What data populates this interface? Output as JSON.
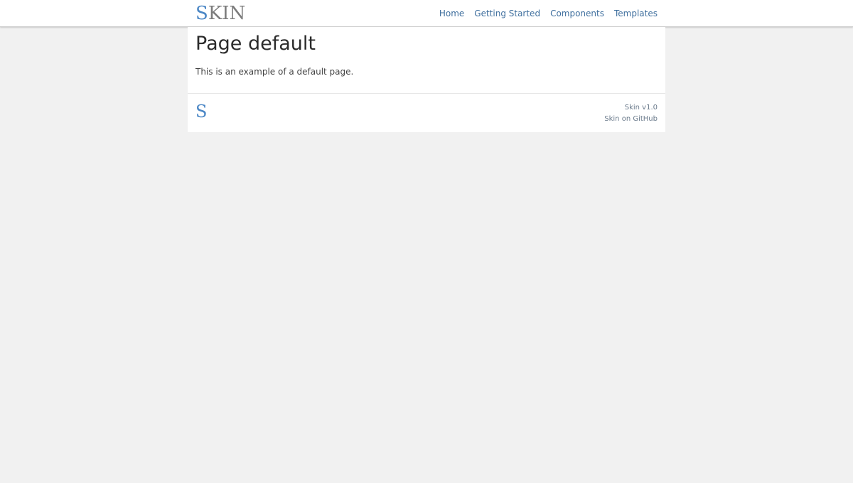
{
  "header": {
    "logo": {
      "first_letter": "S",
      "rest": "KIN"
    },
    "nav": [
      {
        "label": "Home"
      },
      {
        "label": "Getting Started"
      },
      {
        "label": "Components"
      },
      {
        "label": "Templates"
      }
    ]
  },
  "main": {
    "title": "Page default",
    "text": "This is an example of a default page."
  },
  "footer": {
    "logo_letter": "S",
    "links": [
      {
        "label": "Skin v1.0"
      },
      {
        "label": "Skin on GitHub"
      }
    ]
  },
  "colors": {
    "accent": "#4a86c5",
    "nav_link": "#3f6f9e",
    "background": "#f1f1f1",
    "card": "#ffffff"
  }
}
